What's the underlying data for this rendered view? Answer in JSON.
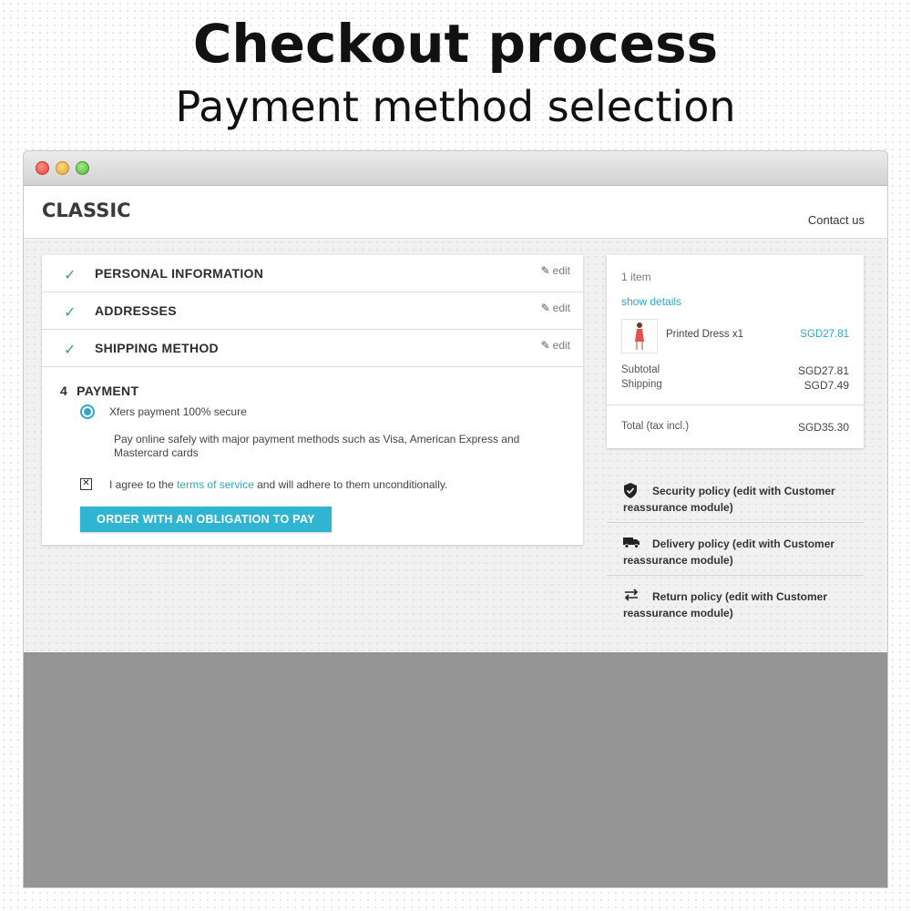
{
  "hero": {
    "title": "Checkout process",
    "subtitle": "Payment method selection"
  },
  "header": {
    "brand": "CLASSIC",
    "contact": "Contact us"
  },
  "steps": [
    {
      "label": "PERSONAL INFORMATION",
      "edit": "edit",
      "icon": "check-icon"
    },
    {
      "label": "ADDRESSES",
      "edit": "edit",
      "icon": "check-icon"
    },
    {
      "label": "SHIPPING METHOD",
      "edit": "edit",
      "icon": "check-icon"
    }
  ],
  "payment": {
    "number": "4",
    "title": "PAYMENT",
    "option_label": "Xfers payment 100% secure",
    "option_selected": true,
    "description": "Pay online safely with major payment methods such as Visa, American Express and Mastercard cards",
    "agree_prefix": "I agree to the",
    "agree_link": "terms of service",
    "agree_suffix": "and will adhere to them unconditionally.",
    "agree_checked": true,
    "order_button": "ORDER WITH AN OBLIGATION TO PAY"
  },
  "cart": {
    "items_count": "1 item",
    "show_details": "show details",
    "product_name": "Printed Dress x1",
    "product_price": "SGD27.81",
    "subtotal_label": "Subtotal",
    "subtotal_value": "SGD27.81",
    "shipping_label": "Shipping",
    "shipping_value": "SGD7.49",
    "total_label": "Total (tax incl.)",
    "total_value": "SGD35.30"
  },
  "reassurance": [
    {
      "icon": "shield-icon",
      "text": "Security policy (edit with Customer reassurance module)"
    },
    {
      "icon": "truck-icon",
      "text": "Delivery policy (edit with Customer reassurance module)"
    },
    {
      "icon": "swap-arrows-icon",
      "text": "Return policy (edit with Customer reassurance module)"
    }
  ],
  "colors": {
    "accent": "#2fb5d2",
    "check": "#3aa85b",
    "link": "#2ea7c6"
  }
}
